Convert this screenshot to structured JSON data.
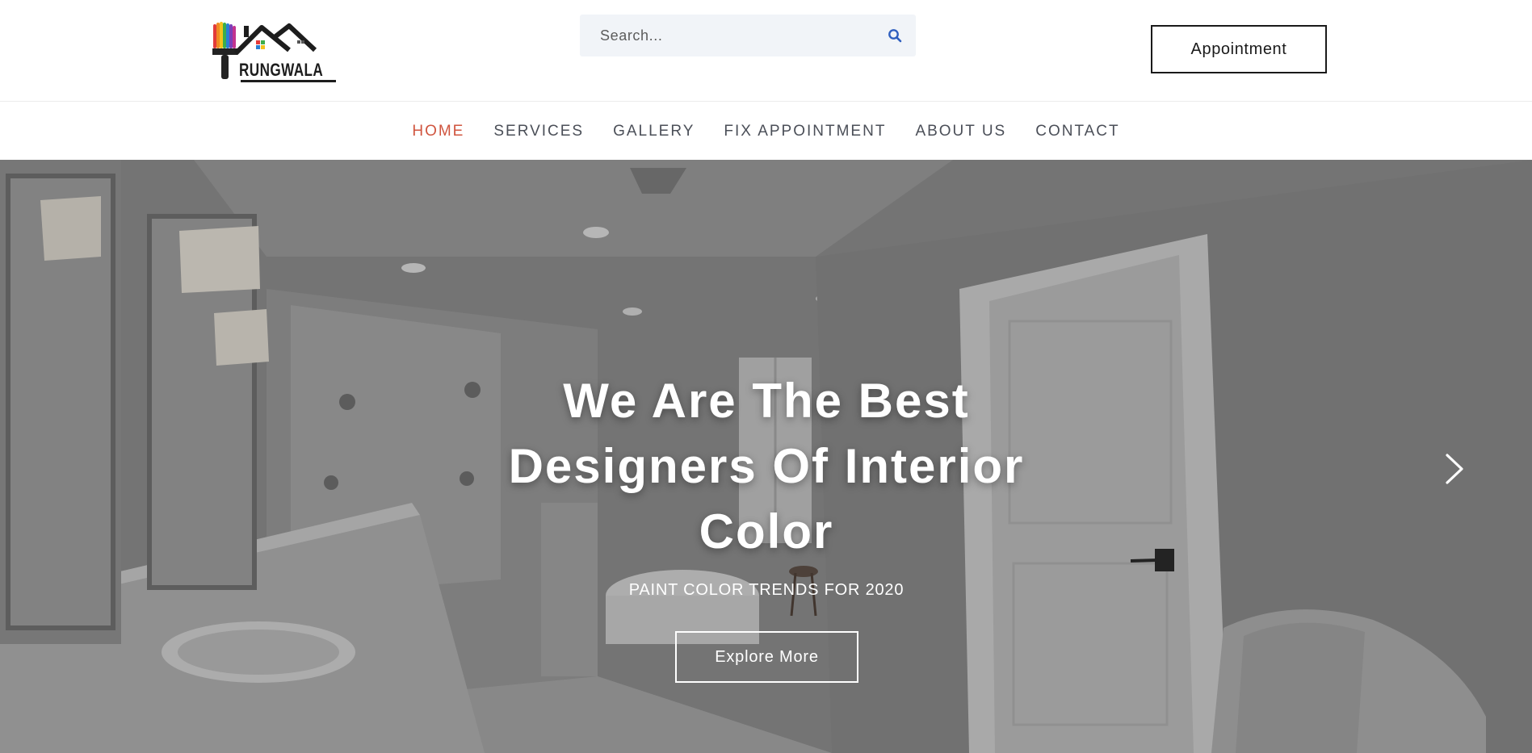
{
  "header": {
    "brand": "RUNGWALA",
    "search": {
      "placeholder": "Search..."
    },
    "appointment_label": "Appointment"
  },
  "nav": {
    "items": [
      {
        "label": "HOME",
        "active": true
      },
      {
        "label": "SERVICES",
        "active": false
      },
      {
        "label": "GALLERY",
        "active": false
      },
      {
        "label": "FIX APPOINTMENT",
        "active": false
      },
      {
        "label": "ABOUT US",
        "active": false
      },
      {
        "label": "CONTACT",
        "active": false
      }
    ]
  },
  "hero": {
    "title_line1": "We Are The Best",
    "title_line2": "Designers Of Interior",
    "title_line3": "Color",
    "subtitle": "PAINT COLOR TRENDS FOR 2020",
    "cta_label": "Explore More"
  },
  "colors": {
    "nav_active": "#d0553f",
    "nav_text": "#4b4f58",
    "search_bg": "#f1f4f8",
    "search_icon": "#2f5fbf"
  }
}
